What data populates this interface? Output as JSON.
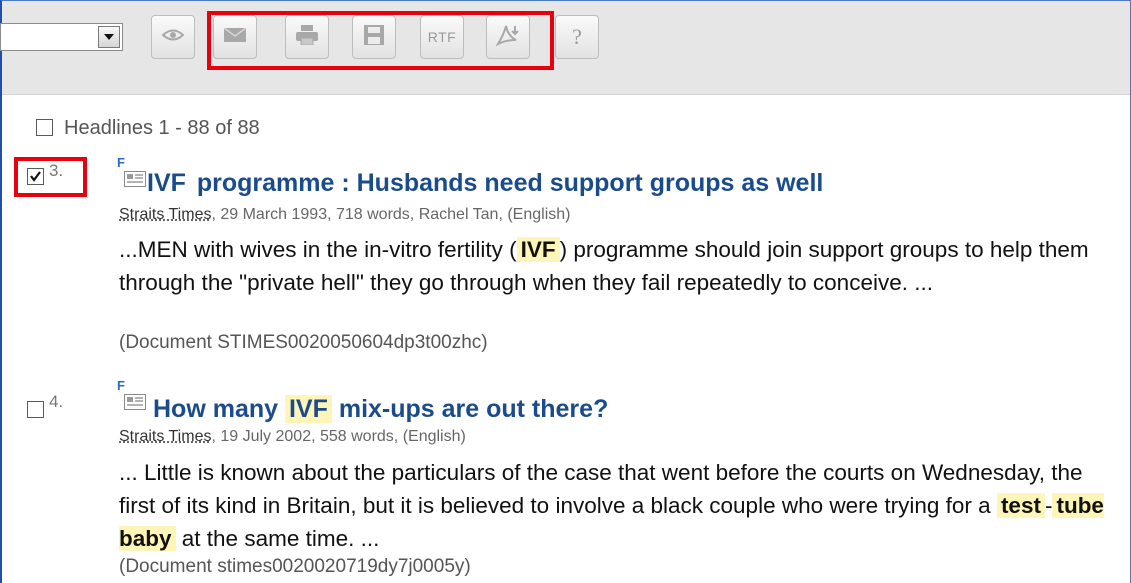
{
  "toolbar": {
    "dropdown_value": "",
    "buttons": [
      {
        "name": "view",
        "icon": "eye-icon"
      },
      {
        "name": "email",
        "icon": "envelope-icon"
      },
      {
        "name": "print",
        "icon": "printer-icon"
      },
      {
        "name": "save",
        "icon": "floppy-disk-icon"
      },
      {
        "name": "rtf",
        "label": "RTF"
      },
      {
        "name": "pdf",
        "icon": "pdf-download-icon"
      },
      {
        "name": "help",
        "label": "?"
      }
    ]
  },
  "results": {
    "headline_label": "Headlines 1 - 88 of 88",
    "items": [
      {
        "number": "3.",
        "checked": true,
        "badge": "F",
        "title_keyword": "IVF",
        "title_rest": "programme : Husbands need support groups as well",
        "source": "Straits Times",
        "meta": ", 29 March 1993, 718 words, Rachel Tan, (English)",
        "snippet_before": "...MEN with wives in the in-vitro fertility (",
        "snippet_keyword": "IVF",
        "snippet_after": ") programme should join support groups to help them through the \"private hell\" they go through when they fail repeatedly to conceive. ...",
        "document_ref": "(Document STIMES0020050604dp3t00zhc)"
      },
      {
        "number": "4.",
        "checked": false,
        "badge": "F",
        "title_before": "How many",
        "title_keyword": "IVF",
        "title_after": "mix-ups are out there?",
        "source": "Straits Times",
        "meta": ", 19 July 2002, 558 words, (English)",
        "snippet_before": "... Little is known about the particulars of the case that went before the courts on Wednesday, the first of its kind in Britain, but it is believed to involve a black couple who were trying for a",
        "snippet_keyword1": "test",
        "snippet_sep": "-",
        "snippet_keyword2": "tube baby",
        "snippet_after": "at the same time. ...",
        "document_ref": "(Document stimes0020020719dy7j0005y)"
      }
    ]
  },
  "colors": {
    "title": "#1a4c8c",
    "highlight": "#fff5b8",
    "annotation_red": "#e8000d",
    "toolbar_bg": "#e6e6e6"
  }
}
